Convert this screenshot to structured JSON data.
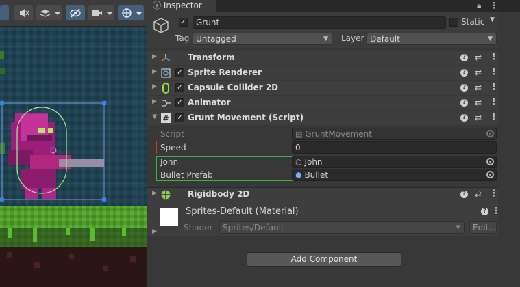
{
  "scene": {
    "toolbar": {
      "buttons": [
        "☰",
        "⋔",
        "≋",
        "◉",
        "▭",
        "⊕"
      ]
    }
  },
  "inspector": {
    "tab_label": "Inspector",
    "object": {
      "enabled": true,
      "name": "Grunt",
      "static_label": "Static",
      "static_checked": false,
      "tag_label": "Tag",
      "tag_value": "Untagged",
      "layer_label": "Layer",
      "layer_value": "Default"
    },
    "components": [
      {
        "name": "Transform",
        "icon": "transform-icon",
        "has_checkbox": false,
        "expanded": false
      },
      {
        "name": "Sprite Renderer",
        "icon": "sprite-renderer-icon",
        "has_checkbox": true,
        "expanded": false
      },
      {
        "name": "Capsule Collider 2D",
        "icon": "capsule-collider-icon",
        "has_checkbox": true,
        "expanded": false
      },
      {
        "name": "Animator",
        "icon": "animator-icon",
        "has_checkbox": true,
        "expanded": false
      },
      {
        "name": "Grunt Movement (Script)",
        "icon": "script-icon",
        "has_checkbox": true,
        "expanded": true
      },
      {
        "name": "Rigidbody 2D",
        "icon": "rigidbody-icon",
        "has_checkbox": false,
        "expanded": false
      }
    ],
    "script_props": {
      "script_label": "Script",
      "script_value": "GruntMovement",
      "speed_label": "Speed",
      "speed_value": "0",
      "john_label": "John",
      "john_value": "John",
      "bullet_label": "Bullet Prefab",
      "bullet_value": "Bullet"
    },
    "material": {
      "name": "Sprites-Default (Material)",
      "shader_label": "Shader",
      "shader_value": "Sprites/Default",
      "edit_label": "Edit..."
    },
    "add_component_label": "Add Component",
    "highlight_colors": {
      "speed": "#c93a3a",
      "refs": "#3fae4b"
    }
  }
}
